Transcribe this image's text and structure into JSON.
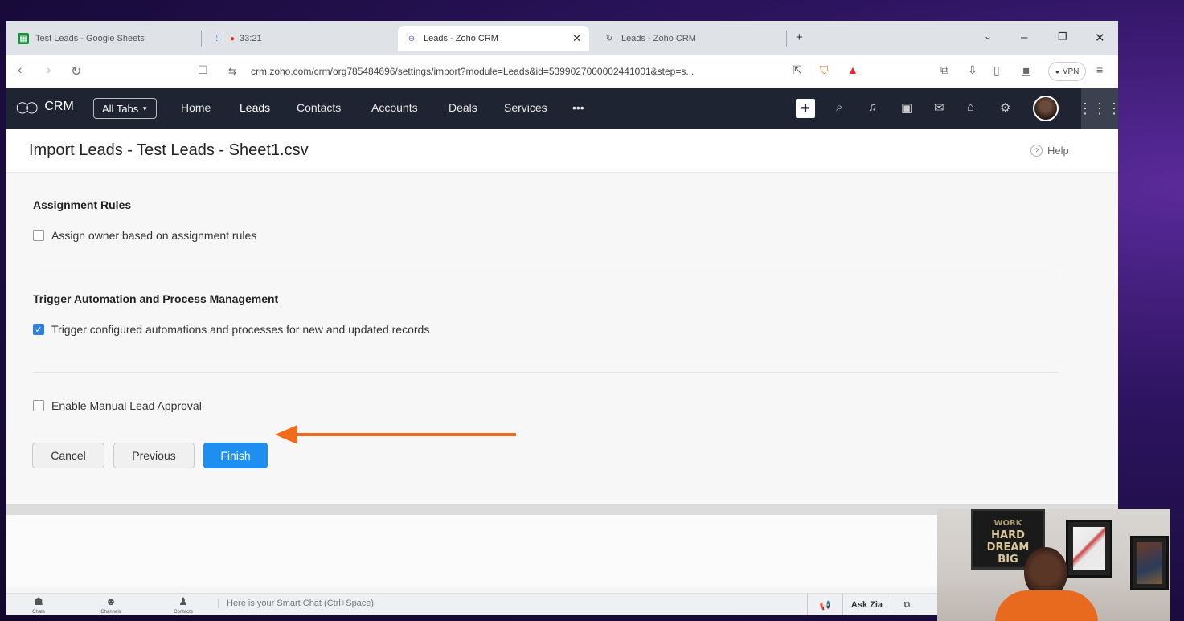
{
  "browser": {
    "tabs": [
      {
        "title": "Test Leads - Google Sheets",
        "icon": "sheets-icon",
        "color": "#1e8e3e"
      },
      {
        "title": "33:21",
        "icon": "recording-icon",
        "color": "#d93025"
      },
      {
        "title": "Leads - Zoho CRM",
        "icon": "zoho-icon",
        "active": true
      },
      {
        "title": "Leads - Zoho CRM",
        "icon": "reload-icon"
      }
    ],
    "new_tab": "+",
    "url": "crm.zoho.com/crm/org785484696/settings/import?module=Leads&id=5399027000002441001&step=s...",
    "vpn_label": "VPN"
  },
  "crm_nav": {
    "logo": "CRM",
    "all_tabs": "All Tabs",
    "links": [
      "Home",
      "Leads",
      "Contacts",
      "Accounts",
      "Deals",
      "Services",
      "•••"
    ],
    "active_link": "Leads",
    "colors": {
      "nav_bg": "#1f2433",
      "primary": "#1f8ef1",
      "arrow": "#f26b1d"
    }
  },
  "page": {
    "title": "Import Leads - Test Leads - Sheet1.csv",
    "help": "Help",
    "assignment_title": "Assignment Rules",
    "assignment_option": {
      "label": "Assign owner based on assignment rules",
      "checked": false
    },
    "trigger_title": "Trigger Automation and Process Management",
    "trigger_option": {
      "label": "Trigger configured automations and processes for new and updated records",
      "checked": true
    },
    "approval_option": {
      "label": "Enable Manual Lead Approval",
      "checked": false
    },
    "buttons": {
      "cancel": "Cancel",
      "previous": "Previous",
      "finish": "Finish"
    }
  },
  "bottom_bar": {
    "items": [
      "Chats",
      "Channels",
      "Contacts"
    ],
    "smart_chat": "Here is your Smart Chat (Ctrl+Space)",
    "ask_zia": "Ask Zia"
  },
  "webcam": {
    "poster_text": [
      "WORK",
      "HARD",
      "DREAM",
      "BIG"
    ]
  }
}
